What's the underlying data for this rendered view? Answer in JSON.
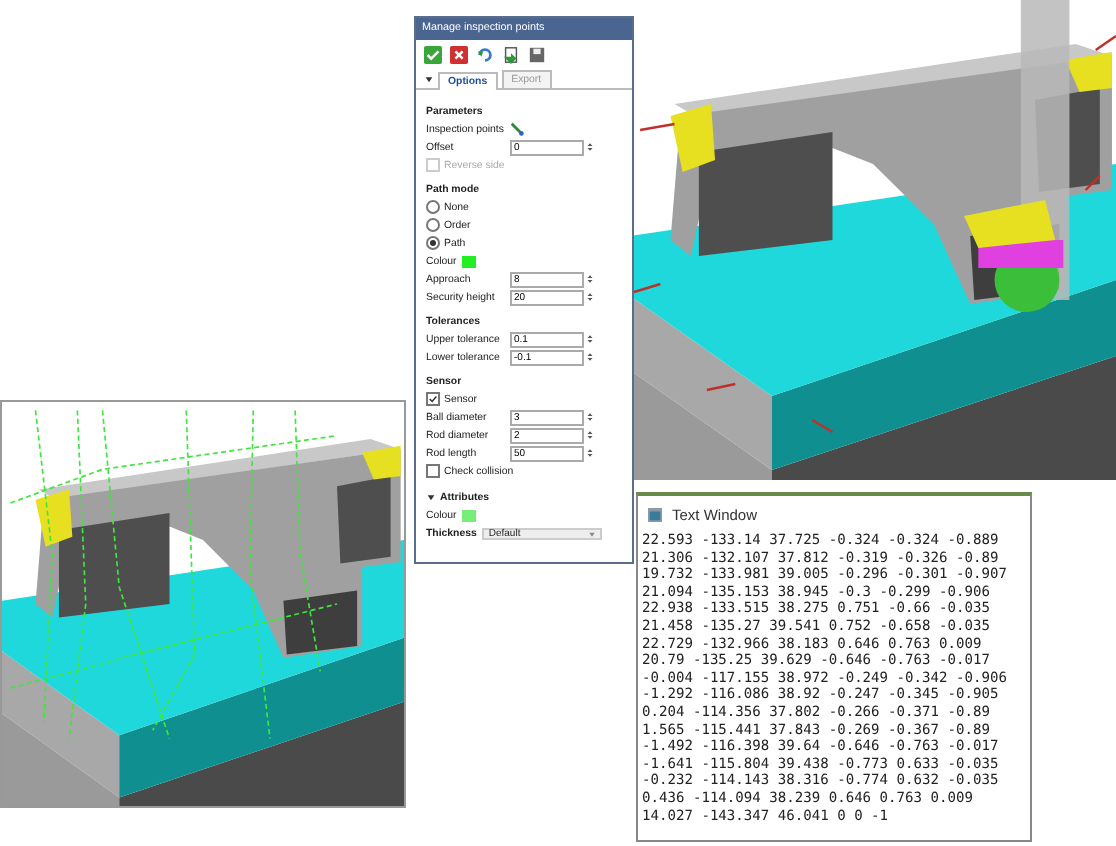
{
  "dialog": {
    "title": "Manage inspection points",
    "tabs": [
      {
        "label": "Options",
        "selected": true
      },
      {
        "label": "Export",
        "selected": false
      }
    ],
    "rows": [
      {
        "kind": "heading",
        "label": "Parameters"
      },
      {
        "kind": "picker",
        "label": "Inspection points"
      },
      {
        "kind": "spin",
        "label": "Offset",
        "value": "0"
      },
      {
        "kind": "checkbox",
        "label": "Reverse side",
        "checked": false,
        "disabled": true
      },
      {
        "kind": "heading",
        "label": "Path mode"
      },
      {
        "kind": "radio",
        "label": "None",
        "selected": false
      },
      {
        "kind": "radio",
        "label": "Order",
        "selected": false
      },
      {
        "kind": "radio",
        "label": "Path",
        "selected": true
      },
      {
        "kind": "colour",
        "label": "Colour",
        "color": "#22ee22"
      },
      {
        "kind": "spin",
        "label": "Approach",
        "value": "8"
      },
      {
        "kind": "spin",
        "label": "Security height",
        "value": "20"
      },
      {
        "kind": "heading",
        "label": "Tolerances"
      },
      {
        "kind": "spin",
        "label": "Upper tolerance",
        "value": "0.1"
      },
      {
        "kind": "spin",
        "label": "Lower tolerance",
        "value": "-0.1"
      },
      {
        "kind": "heading",
        "label": "Sensor"
      },
      {
        "kind": "checkbox",
        "label": "Sensor",
        "checked": true,
        "disabled": false
      },
      {
        "kind": "spin",
        "label": "Ball diameter",
        "value": "3"
      },
      {
        "kind": "spin",
        "label": "Rod diameter",
        "value": "2"
      },
      {
        "kind": "spin",
        "label": "Rod length",
        "value": "50"
      },
      {
        "kind": "checkbox",
        "label": "Check collision",
        "checked": false,
        "disabled": false
      },
      {
        "kind": "section",
        "label": "Attributes",
        "expanded": true
      },
      {
        "kind": "colour",
        "label": "Colour",
        "color": "#77ee77"
      },
      {
        "kind": "dropdown",
        "label": "Thickness",
        "value": "Default"
      }
    ]
  },
  "text_window": {
    "title": "Text Window",
    "lines": [
      "22.593 -133.14 37.725 -0.324 -0.324 -0.889",
      "21.306 -132.107 37.812 -0.319 -0.326 -0.89",
      "19.732 -133.981 39.005 -0.296 -0.301 -0.907",
      "21.094 -135.153 38.945 -0.3 -0.299 -0.906",
      "22.938 -133.515 38.275 0.751 -0.66 -0.035",
      "21.458 -135.27 39.541 0.752 -0.658 -0.035",
      "22.729 -132.966 38.183 0.646 0.763 0.009",
      "20.79 -135.25 39.629 -0.646 -0.763 -0.017",
      "-0.004 -117.155 38.972 -0.249 -0.342 -0.906",
      "-1.292 -116.086 38.92 -0.247 -0.345 -0.905",
      "0.204 -114.356 37.802 -0.266 -0.371 -0.89",
      "1.565 -115.441 37.843 -0.269 -0.367 -0.89",
      "-1.492 -116.398 39.64 -0.646 -0.763 -0.017",
      "-1.641 -115.804 39.438 -0.773 0.633 -0.035",
      "-0.232 -114.143 38.316 -0.774 0.632 -0.035",
      "0.436 -114.094 38.239 0.646 0.763 0.009",
      "14.027 -143.347 46.041 0 0 -1"
    ]
  }
}
